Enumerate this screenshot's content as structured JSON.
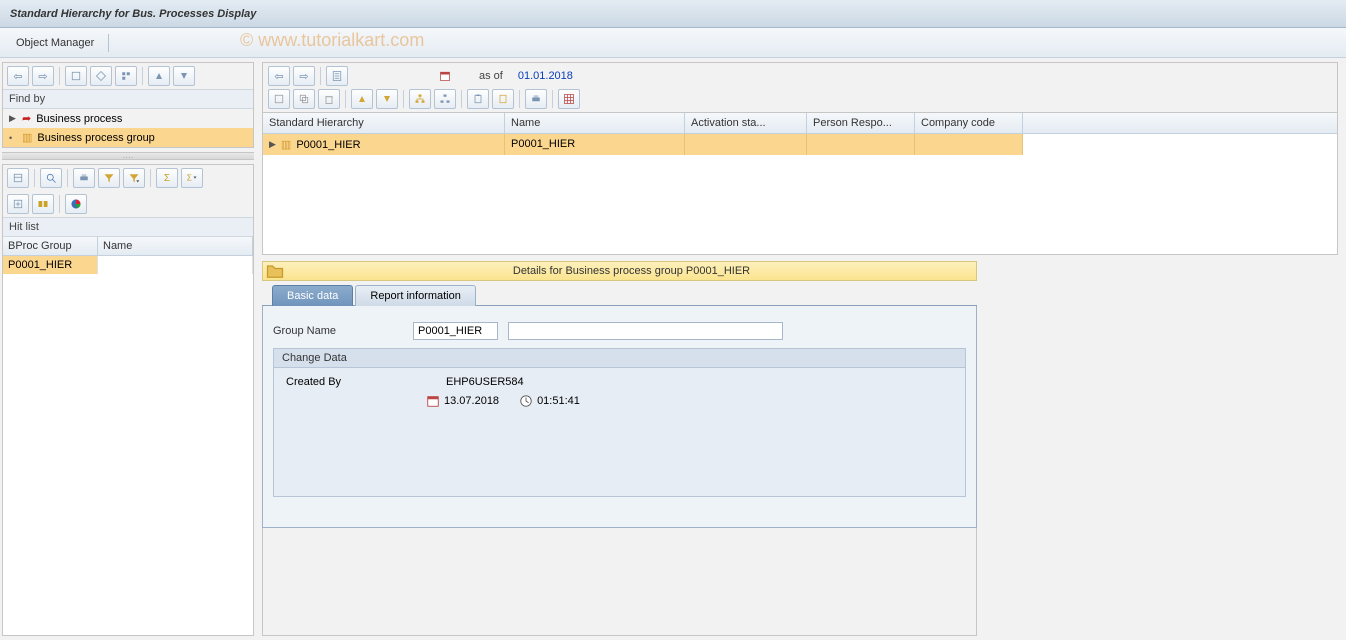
{
  "window": {
    "title": "Standard Hierarchy for Bus. Processes Display"
  },
  "app_toolbar": {
    "object_manager": "Object Manager"
  },
  "watermark": "© www.tutorialkart.com",
  "findby": {
    "title": "Find by",
    "items": [
      {
        "label": "Business process"
      },
      {
        "label": "Business process group"
      }
    ]
  },
  "hitlist": {
    "title": "Hit list",
    "columns": {
      "group": "BProc Group",
      "name": "Name"
    },
    "rows": [
      {
        "group": "P0001_HIER",
        "name": ""
      }
    ]
  },
  "right_toolbar": {
    "asof_label": "as of",
    "asof_date": "01.01.2018"
  },
  "hierarchy": {
    "columns": {
      "std": "Standard Hierarchy",
      "name": "Name",
      "act": "Activation sta...",
      "pers": "Person Respo...",
      "comp": "Company code"
    },
    "rows": [
      {
        "std": "P0001_HIER",
        "name": "P0001_HIER",
        "act": "",
        "pers": "",
        "comp": ""
      }
    ]
  },
  "details": {
    "bar_title": "Details for Business process group P0001_HIER",
    "tabs": {
      "basic": "Basic data",
      "report": "Report information"
    },
    "form": {
      "group_name_label": "Group Name",
      "group_name_value": "P0001_HIER",
      "group_desc_value": ""
    },
    "change_data": {
      "title": "Change Data",
      "created_by_label": "Created By",
      "created_by_value": "EHP6USER584",
      "date": "13.07.2018",
      "time": "01:51:41"
    }
  }
}
